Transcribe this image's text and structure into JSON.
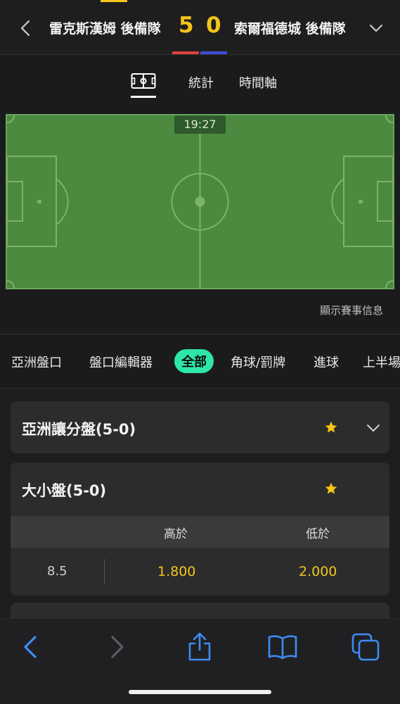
{
  "header": {
    "home_team": "雷克斯漢姆 後備隊",
    "away_team": "索爾福德城 後備隊",
    "home_score": "5",
    "away_score": "0",
    "colors": {
      "home": "#e0423a",
      "away": "#3b4fd8",
      "score": "#f5c518"
    }
  },
  "view_tabs": {
    "pitch_icon": "pitch-icon",
    "stats": "統計",
    "timeline": "時間軸"
  },
  "match": {
    "clock": "19:27",
    "show_info": "顯示賽事信息"
  },
  "filters": [
    "亞洲盤口",
    "盤口編輯器",
    "全部",
    "角球/罰牌",
    "進球",
    "上半場"
  ],
  "active_filter": "全部",
  "markets": [
    {
      "title": "亞洲讓分盤(5-0)",
      "starred": true,
      "expanded": false
    },
    {
      "title": "大小盤(5-0)",
      "starred": true,
      "expanded": true,
      "columns": [
        "高於",
        "低於"
      ],
      "rows": [
        {
          "line": "8.5",
          "over": "1.800",
          "under": "2.000"
        }
      ]
    }
  ],
  "toolbar": {
    "icons": [
      "back-icon",
      "forward-icon",
      "share-icon",
      "bookmarks-icon",
      "tabs-icon"
    ]
  },
  "accent": "#2ee6a6"
}
